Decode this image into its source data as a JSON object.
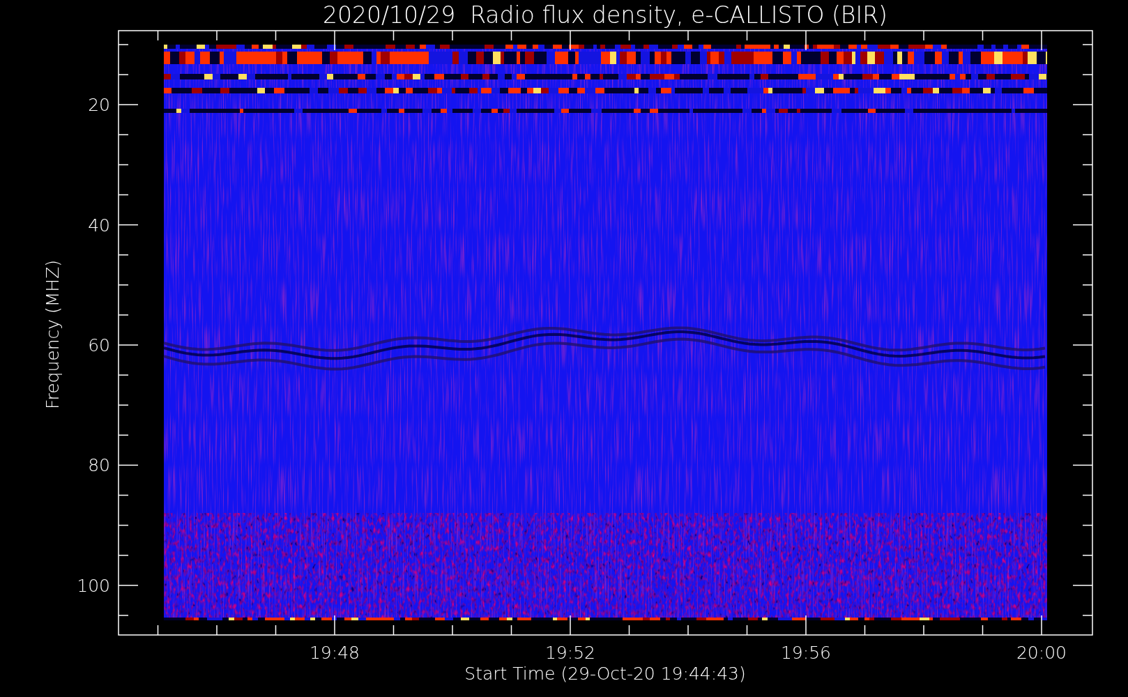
{
  "chart": {
    "title": "2020/10/29  Radio flux density, e-CALLISTO (BIR)",
    "ylabel": "Frequency (MHZ)",
    "xlabel": "Start Time (29-Oct-20 19:44:43)",
    "y_tick_labels": [
      "20",
      "40",
      "60",
      "80",
      "100"
    ],
    "x_tick_labels": [
      "19:48",
      "19:52",
      "19:56",
      "20:00"
    ]
  }
}
